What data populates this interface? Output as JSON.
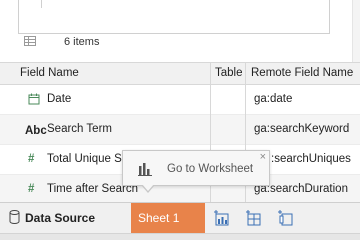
{
  "preview": {
    "items_count": "6 items"
  },
  "table": {
    "headers": {
      "field_name": "Field Name",
      "table": "Table",
      "remote_field_name": "Remote Field Name"
    },
    "rows": [
      {
        "icon": "calendar-icon",
        "field_name": "Date",
        "table": "",
        "remote_field_name": "ga:date"
      },
      {
        "icon": "abc-string-icon",
        "icon_text": "Abc",
        "field_name": "Search Term",
        "table": "",
        "remote_field_name": "ga:searchKeyword"
      },
      {
        "icon": "number-hash-icon",
        "icon_text": "#",
        "field_name": "Total Unique S",
        "table": "",
        "remote_field_name": ":searchUniques"
      },
      {
        "icon": "number-hash-icon",
        "icon_text": "#",
        "field_name": "Time after Search",
        "table": "",
        "remote_field_name": "ga:searchDuration"
      }
    ]
  },
  "tooltip": {
    "label": "Go to Worksheet",
    "close": "×"
  },
  "bottom_bar": {
    "data_source_label": "Data Source",
    "sheet_label": "Sheet 1"
  },
  "colors": {
    "sheet_tab": "#e8834a",
    "type_icon": "#3a6fb5",
    "number_icon": "#4a8a5a"
  }
}
